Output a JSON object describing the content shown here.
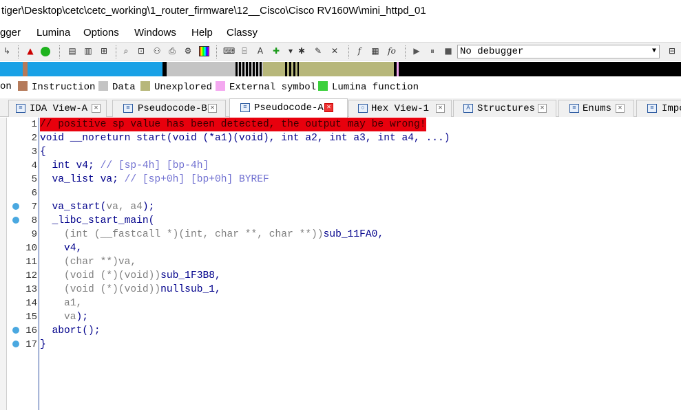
{
  "window": {
    "title": "tiger\\Desktop\\cetc\\cetc_working\\1_router_firmware\\12__Cisco\\Cisco RV160W\\mini_httpd_01"
  },
  "menu": [
    "gger",
    "Lumina",
    "Options",
    "Windows",
    "Help",
    "Classy"
  ],
  "toolbar": {
    "debugger_value": "No debugger"
  },
  "legend": [
    {
      "label": "on",
      "color": "#3aa3e3"
    },
    {
      "label": "Instruction",
      "color": "#b57a5a"
    },
    {
      "label": "Data",
      "color": "#c4c4c4"
    },
    {
      "label": "Unexplored",
      "color": "#b7b77a"
    },
    {
      "label": "External symbol",
      "color": "#f4a8f0"
    },
    {
      "label": "Lumina function",
      "color": "#3cd03c"
    }
  ],
  "tabs": [
    {
      "label": "IDA View-A",
      "active": false
    },
    {
      "label": "Pseudocode-B",
      "active": false
    },
    {
      "label": "Pseudocode-A",
      "active": true
    },
    {
      "label": "Hex View-1",
      "active": false
    },
    {
      "label": "Structures",
      "active": false
    },
    {
      "label": "Enums",
      "active": false
    },
    {
      "label": "Impo",
      "active": false
    }
  ],
  "code": {
    "line_numbers": [
      "1",
      "2",
      "3",
      "4",
      "5",
      "6",
      "7",
      "8",
      "9",
      "10",
      "11",
      "12",
      "13",
      "14",
      "15",
      "16",
      "17"
    ],
    "breakpoint_lines": [
      "7",
      "8",
      "16",
      "17"
    ],
    "l1": "// positive sp value has been detected, the output may be wrong!",
    "l2a": "void __noreturn start(void (*a1)(void), int a2, int a3, int a4, ...)",
    "l3": "{",
    "l4a": "  int v4; ",
    "l4b": "// [sp-4h] [bp-4h]",
    "l5a": "  va_list va; ",
    "l5b": "// [sp+0h] [bp+0h] BYREF",
    "l7a": "  va_start(",
    "l7b": "va, a4",
    "l7c": ");",
    "l8": "  _libc_start_main(",
    "l9a": "    (int (__fastcall *)(int, char **, char **))",
    "l9b": "sub_11FA0,",
    "l10": "    v4,",
    "l11a": "    (char **)",
    "l11b": "va,",
    "l12a": "    (void (*)(void))",
    "l12b": "sub_1F3B8,",
    "l13a": "    (void (*)(void))",
    "l13b": "nullsub_1,",
    "l14a": "    ",
    "l14b": "a1,",
    "l15a": "    ",
    "l15b": "va",
    "l15c": ");",
    "l16": "  abort();",
    "l17": "}"
  }
}
